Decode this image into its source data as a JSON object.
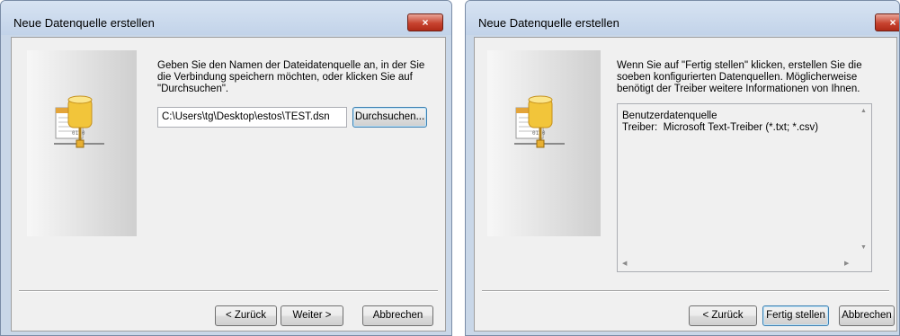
{
  "dialog1": {
    "title": "Neue Datenquelle erstellen",
    "close_label": "×",
    "description": "Geben Sie den Namen der Dateidatenquelle an, in der Sie die Verbindung speichern möchten, oder klicken Sie auf \"Durchsuchen\".",
    "path_value": "C:\\Users\\tg\\Desktop\\estos\\TEST.dsn",
    "browse_label": "Durchsuchen...",
    "back_label": "< Zurück",
    "next_label": "Weiter >",
    "cancel_label": "Abbrechen"
  },
  "dialog2": {
    "title": "Neue Datenquelle erstellen",
    "close_label": "×",
    "description": "Wenn Sie auf \"Fertig stellen\" klicken, erstellen Sie die soeben konfigurierten Datenquellen. Möglicherweise benötigt der Treiber weitere Informationen von Ihnen.",
    "summary_line1": "Benutzerdatenquelle",
    "summary_line2": "Treiber:  Microsoft Text-Treiber (*.txt; *.csv)",
    "back_label": "< Zurück",
    "finish_label": "Fertig stellen",
    "cancel_label": "Abbrechen"
  },
  "icons": [
    "datasource-wizard-icon",
    "close-icon",
    "scroll-up-icon",
    "scroll-down-icon",
    "scroll-left-icon",
    "scroll-right-icon"
  ],
  "colors": {
    "close_button": "#c7432f",
    "frame": "#c9d7e8",
    "client": "#f0f0f0",
    "focus_border": "#3c7fb1"
  }
}
